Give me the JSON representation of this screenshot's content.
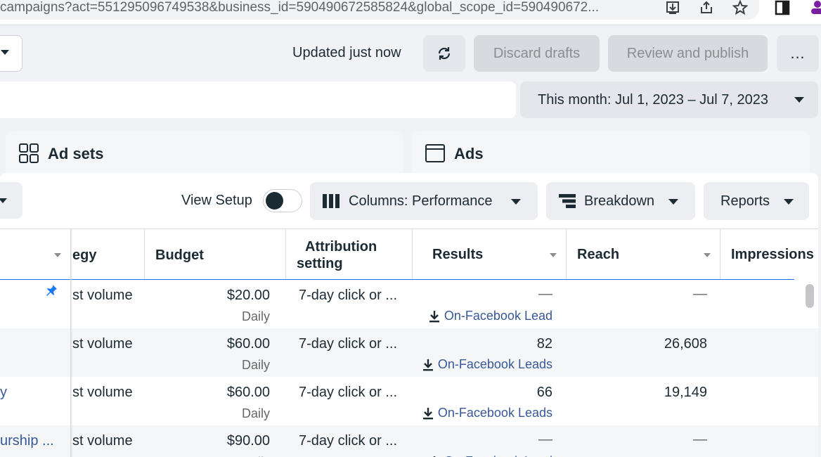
{
  "browser": {
    "url": "campaigns?act=551295096749538&business_id=590490672585824&global_scope_id=590490672..."
  },
  "toolbar": {
    "status": "Updated just now",
    "discard_label": "Discard drafts",
    "publish_label": "Review and publish",
    "more_label": "…"
  },
  "date_range": "This month: Jul 1, 2023 – Jul 7, 2023",
  "tabs": {
    "ad_sets": "Ad sets",
    "ads": "Ads"
  },
  "table_toolbar": {
    "view_setup": "View Setup",
    "columns_label": "Columns: Performance",
    "breakdown_label": "Breakdown",
    "reports_label": "Reports"
  },
  "columns": {
    "strategy": "egy",
    "budget": "Budget",
    "attribution_line1": "Attribution",
    "attribution_line2": "setting",
    "results": "Results",
    "reach": "Reach",
    "impressions": "Impressions"
  },
  "rows": [
    {
      "name": "",
      "strategy": "st volume",
      "budget": "$20.00",
      "budget_type": "Daily",
      "attribution": "7-day click or ...",
      "results": "—",
      "result_type": "On-Facebook Lead",
      "reach": "—"
    },
    {
      "name": "",
      "strategy": "st volume",
      "budget": "$60.00",
      "budget_type": "Daily",
      "attribution": "7-day click or ...",
      "results": "82",
      "result_type": "On-Facebook Leads",
      "reach": "26,608"
    },
    {
      "name": "y",
      "strategy": "st volume",
      "budget": "$60.00",
      "budget_type": "Daily",
      "attribution": "7-day click or ...",
      "results": "66",
      "result_type": "On-Facebook Leads",
      "reach": "19,149"
    },
    {
      "name": "urship ...",
      "strategy": "st volume",
      "budget": "$90.00",
      "budget_type": "Daily",
      "attribution": "7-day click or ...",
      "results": "—",
      "result_type": "On-Facebook Lead",
      "reach": "—"
    }
  ]
}
